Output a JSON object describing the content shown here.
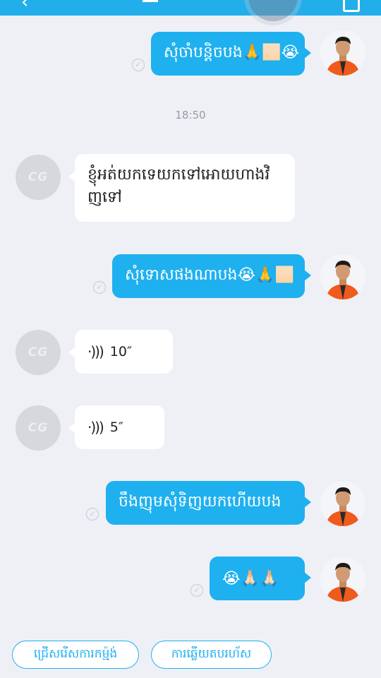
{
  "timestamp": "18:50",
  "placeholder_initials": "CG",
  "messages": [
    {
      "text": "សុំចាំបន្តិចបង🙏🏻😭"
    },
    {
      "text": "ខ្ញុំអត់យកទេយកទៅអោយហាងវិញទៅ"
    },
    {
      "text": "សុំទោសផងណាបង😭🙏🏻"
    },
    {
      "duration": "10″"
    },
    {
      "duration": "5″"
    },
    {
      "text": "ចឹងញុមសុំទិញយកហើយបង"
    },
    {
      "text": "😭🙏🏻🙏🏻"
    }
  ],
  "quick_replies": [
    "ជ្រើសរើសការកម្ម៉ង់",
    "ការឆ្លើយតបរហ័ស"
  ],
  "colors": {
    "accent": "#1fb0ef",
    "background": "#eef0f6",
    "jacket": "#f05a1c"
  }
}
